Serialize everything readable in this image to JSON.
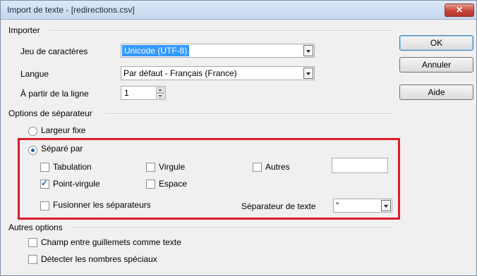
{
  "window": {
    "title": "Import de texte - [redirections.csv]",
    "close_glyph": "✕"
  },
  "buttons": {
    "ok": "OK",
    "cancel": "Annuler",
    "help": "Aide"
  },
  "importer": {
    "section_label": "Importer",
    "charset_label": "Jeu de caractères",
    "charset_value": "Unicode (UTF-8)",
    "language_label": "Langue",
    "language_value": "Par défaut - Français (France)",
    "from_line_label": "À partir de la ligne",
    "from_line_value": "1"
  },
  "separator_options": {
    "section_label": "Options de séparateur",
    "fixed_width_label": "Largeur fixe",
    "separated_by_label": "Séparé par",
    "tab_label": "Tabulation",
    "comma_label": "Virgule",
    "other_label": "Autres",
    "semicolon_label": "Point-virgule",
    "space_label": "Espace",
    "merge_label": "Fusionner les séparateurs",
    "text_delimiter_label": "Séparateur de texte",
    "text_delimiter_value": "\"",
    "checked": {
      "semicolon": true,
      "tab": false,
      "comma": false,
      "other": false,
      "space": false,
      "merge": false
    },
    "mode": "separated",
    "highlight_color": "#dd1c2a"
  },
  "other_options": {
    "section_label": "Autres options",
    "quoted_as_text_label": "Champ entre guillemets comme texte",
    "detect_special_label": "Détecter les nombres spéciaux"
  }
}
